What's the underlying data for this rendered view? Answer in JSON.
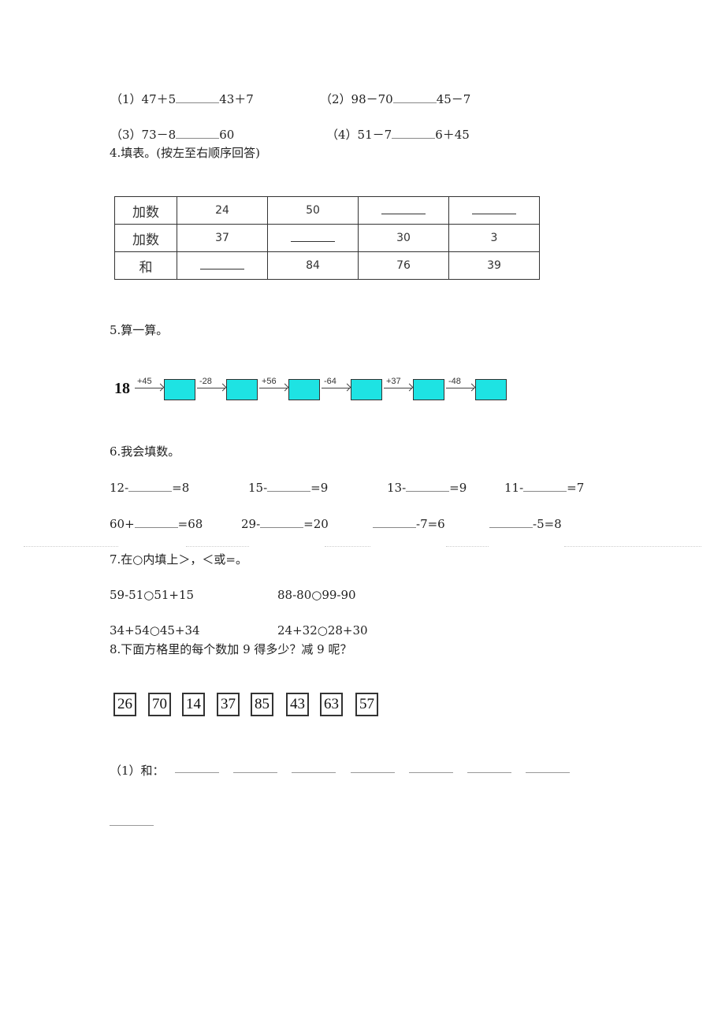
{
  "section3": {
    "items": [
      {
        "label": "（1）47＋5",
        "right": "43＋7"
      },
      {
        "label": "（2）98－70",
        "right": "45－7"
      },
      {
        "label": "（3）73－8",
        "right": "60"
      },
      {
        "label": "（4）51－7",
        "right": "6＋45"
      }
    ]
  },
  "section4": {
    "title": "4.填表。(按左至右顺序回答)",
    "rows": [
      {
        "header": "加数",
        "cells": [
          "24",
          "50",
          "",
          ""
        ]
      },
      {
        "header": "加数",
        "cells": [
          "37",
          "",
          "30",
          "3"
        ]
      },
      {
        "header": "和",
        "cells": [
          "",
          "84",
          "76",
          "39"
        ]
      }
    ]
  },
  "section5": {
    "title": "5.算一算。",
    "start": "18",
    "ops": [
      "+45",
      "-28",
      "+56",
      "-64",
      "+37",
      "-48"
    ],
    "box_color": "#1ee3e3"
  },
  "section6": {
    "title": "6.我会填数。",
    "row1": [
      {
        "pre": "12-",
        "post": "=8"
      },
      {
        "pre": "15-",
        "post": "=9"
      },
      {
        "pre": "13-",
        "post": "=9"
      },
      {
        "pre": "11-",
        "post": "=7"
      }
    ],
    "row2": [
      {
        "pre": "60+",
        "post": "=68"
      },
      {
        "pre": "29-",
        "post": "=20"
      },
      {
        "pre": "",
        "post": "-7=6"
      },
      {
        "pre": "",
        "post": "-5=8"
      }
    ]
  },
  "section7": {
    "title": "7.在○内填上＞，＜或=。",
    "items": [
      "59-51○51+15",
      "88-80○99-90",
      "34+54○45+34",
      "24+32○28+30"
    ]
  },
  "section8": {
    "title": "8.下面方格里的每个数加 9 得多少？减 9 呢？",
    "numbers": [
      "26",
      "70",
      "14",
      "37",
      "85",
      "43",
      "63",
      "57"
    ],
    "sum_label": "（1）和："
  }
}
